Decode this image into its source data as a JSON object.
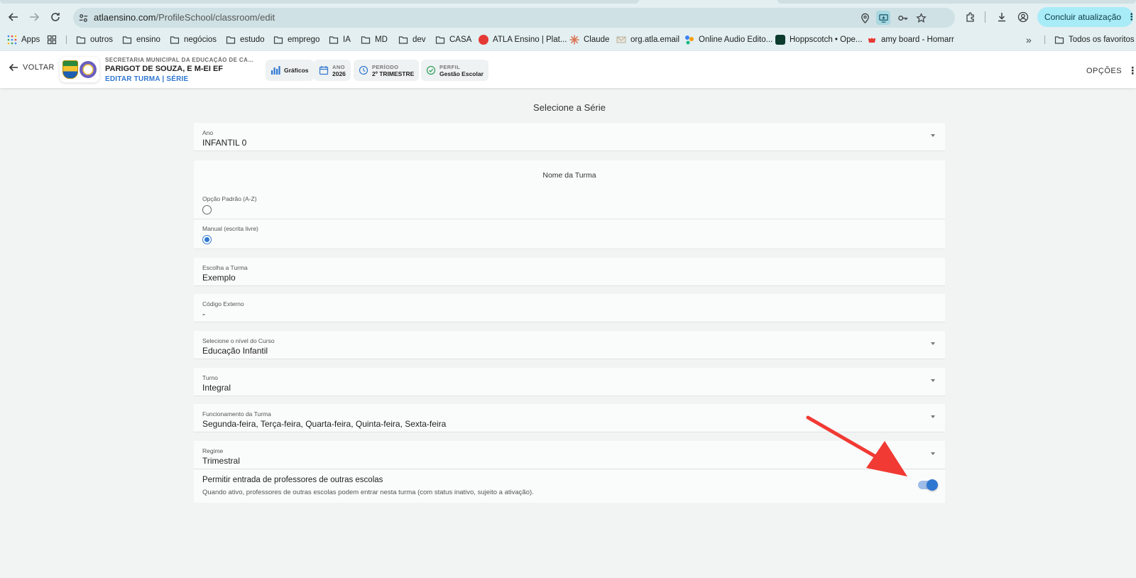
{
  "browser": {
    "url_domain": "atlaensino.com",
    "url_path": "/ProfileSchool/classroom/edit",
    "update_label": "Concluir atualização",
    "bookmarks": [
      {
        "label": "Apps",
        "icon": "apps-grid-icon"
      },
      {
        "label": "outros",
        "icon": "folder-icon"
      },
      {
        "label": "ensino",
        "icon": "folder-icon"
      },
      {
        "label": "negócios",
        "icon": "folder-icon"
      },
      {
        "label": "estudo",
        "icon": "folder-icon"
      },
      {
        "label": "emprego",
        "icon": "folder-icon"
      },
      {
        "label": "IA",
        "icon": "folder-icon"
      },
      {
        "label": "MD",
        "icon": "folder-icon"
      },
      {
        "label": "dev",
        "icon": "folder-icon"
      },
      {
        "label": "CASA",
        "icon": "folder-icon"
      },
      {
        "label": "ATLA Ensino | Plat...",
        "icon": "atla-favicon"
      },
      {
        "label": "Claude",
        "icon": "claude-favicon"
      },
      {
        "label": "org.atla.email",
        "icon": "mail-favicon"
      },
      {
        "label": "Online Audio Edito...",
        "icon": "audio-favicon"
      },
      {
        "label": "Hoppscotch • Ope...",
        "icon": "hoppscotch-favicon"
      },
      {
        "label": "amy board - Homarr",
        "icon": "homarr-favicon"
      }
    ],
    "all_bookmarks_label": "Todos os favoritos"
  },
  "header": {
    "back_label": "VOLTAR",
    "secretaria": "SECRETARIA MUNICIPAL DA EDUCAÇÃO DE CAM...",
    "school_name": "PARIGOT DE SOUZA, E M-EI EF",
    "subtitle": "EDITAR TURMA | SÉRIE",
    "chips": {
      "graficos": "Gráficos",
      "ano_label": "ANO",
      "ano_value": "2026",
      "periodo_label": "PERÍODO",
      "periodo_value": "2º TRIMESTRE",
      "perfil_label": "PERFIL",
      "perfil_value": "Gestão Escolar"
    },
    "options_label": "OPÇÕES"
  },
  "form": {
    "title": "Selecione a Série",
    "ano": {
      "label": "Ano",
      "value": "INFANTIL 0"
    },
    "nome_turma": {
      "title": "Nome da Turma",
      "option_default": "Opção Padrão (A-Z)",
      "option_manual": "Manual (escrita livre)",
      "selected": "manual"
    },
    "escolha_turma": {
      "label": "Escolha a Turma",
      "value": "Exemplo"
    },
    "codigo_externo": {
      "label": "Código Externo",
      "value": "-"
    },
    "nivel_curso": {
      "label": "Selecione o nível do Curso",
      "value": "Educação Infantil"
    },
    "turno": {
      "label": "Turno",
      "value": "Integral"
    },
    "funcionamento": {
      "label": "Funcionamento da Turma",
      "value": "Segunda-feira, Terça-feira, Quarta-feira, Quinta-feira, Sexta-feira"
    },
    "regime": {
      "label": "Regime",
      "value": "Trimestral"
    },
    "permitir": {
      "title": "Permitir entrada de professores de outras escolas",
      "description": "Quando ativo, professores de outras escolas podem entrar nesta turma (com status inativo, sujeito a ativação).",
      "enabled": true
    }
  },
  "colors": {
    "accent": "#2f78d1",
    "annotation_arrow": "#f03a33",
    "update_button": "#a8ecf8"
  }
}
